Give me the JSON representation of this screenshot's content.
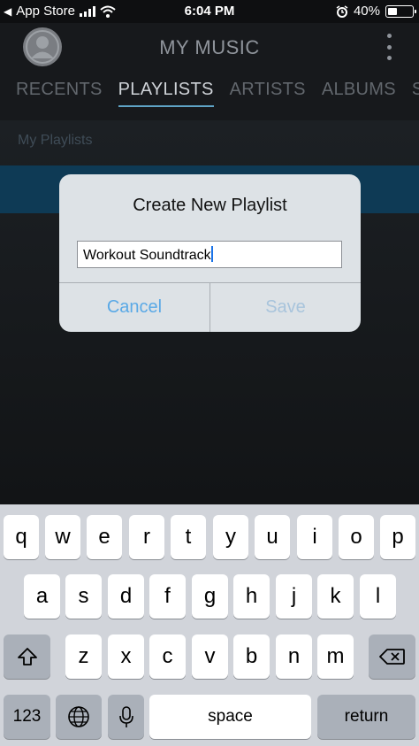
{
  "status_bar": {
    "back_label": "◀",
    "carrier": "App Store",
    "time": "6:04 PM",
    "battery": "40%",
    "battery_level": 0.4,
    "icons": [
      "signal-icon",
      "wifi-icon",
      "alarm-icon",
      "battery-icon"
    ]
  },
  "header": {
    "title": "MY MUSIC",
    "tabs": [
      {
        "label": "RECENTS",
        "active": false
      },
      {
        "label": "PLAYLISTS",
        "active": true
      },
      {
        "label": "ARTISTS",
        "active": false
      },
      {
        "label": "ALBUMS",
        "active": false
      },
      {
        "label": "SO",
        "active": false
      }
    ]
  },
  "content": {
    "section_label": "My Playlists"
  },
  "dialog": {
    "title": "Create New Playlist",
    "input_value": "Workout Soundtrack",
    "cancel_label": "Cancel",
    "save_label": "Save"
  },
  "keyboard": {
    "row1": [
      "q",
      "w",
      "e",
      "r",
      "t",
      "y",
      "u",
      "i",
      "o",
      "p"
    ],
    "row2": [
      "a",
      "s",
      "d",
      "f",
      "g",
      "h",
      "j",
      "k",
      "l"
    ],
    "row3": [
      "z",
      "x",
      "c",
      "v",
      "b",
      "n",
      "m"
    ],
    "numbers_label": "123",
    "space_label": "space",
    "return_label": "return"
  },
  "colors": {
    "accent": "#5aa9e6",
    "tab_underline": "#5fa4c6",
    "header_bg": "#17191c"
  }
}
